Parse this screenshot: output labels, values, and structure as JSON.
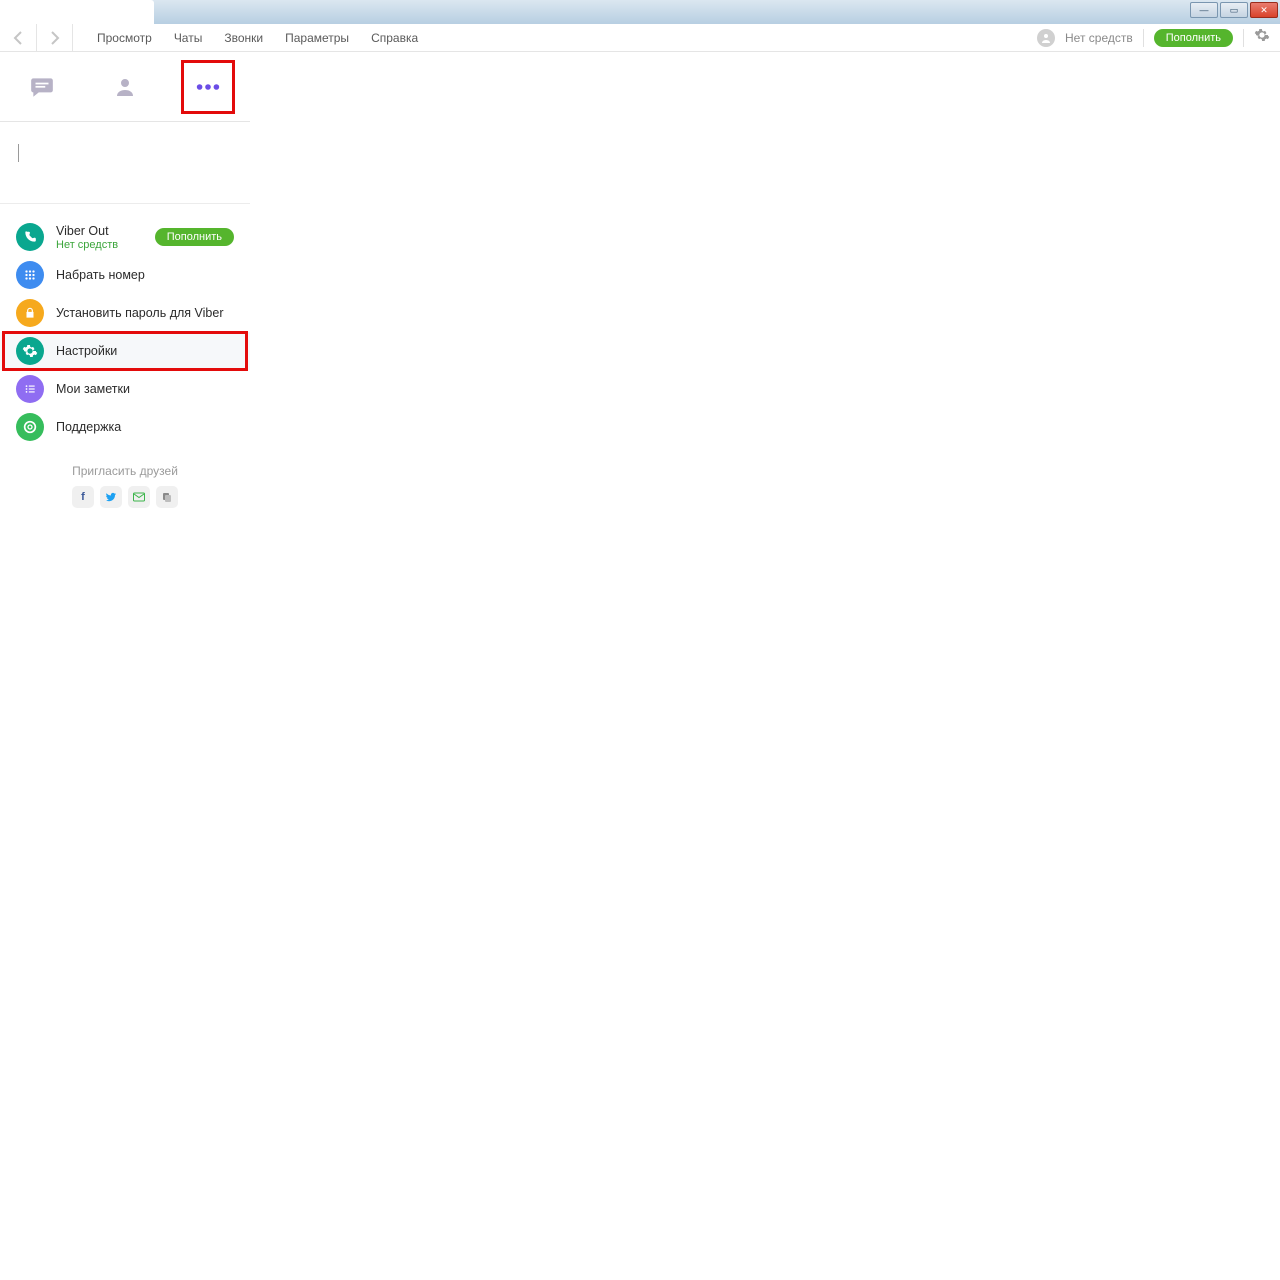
{
  "window": {
    "controls": {
      "min": "—",
      "max": "▭",
      "close": "✕"
    }
  },
  "menubar": {
    "items": [
      "Просмотр",
      "Чаты",
      "Звонки",
      "Параметры",
      "Справка"
    ],
    "credit_status": "Нет средств",
    "topup": "Пополнить"
  },
  "sidebar": {
    "viber_out": {
      "title": "Viber Out",
      "status": "Нет средств",
      "action": "Пополнить"
    },
    "items": [
      {
        "label": "Набрать номер"
      },
      {
        "label": "Установить пароль для Viber"
      },
      {
        "label": "Настройки"
      },
      {
        "label": "Мои заметки"
      },
      {
        "label": "Поддержка"
      }
    ],
    "invite": {
      "title": "Пригласить друзей"
    }
  }
}
